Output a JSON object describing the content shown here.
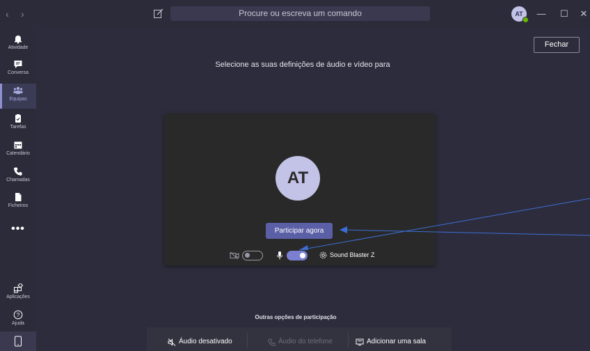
{
  "titlebar": {
    "back": "‹",
    "forward": "›",
    "search_placeholder": "Procure ou escreva um comando",
    "avatar_initials": "AT",
    "minimize": "—",
    "maximize": "☐",
    "close": "✕"
  },
  "rail": {
    "items": [
      {
        "label": "Atividade",
        "icon": "bell-icon"
      },
      {
        "label": "Conversa",
        "icon": "chat-icon"
      },
      {
        "label": "Equipas",
        "icon": "teams-icon"
      },
      {
        "label": "Tarefas",
        "icon": "tasks-icon"
      },
      {
        "label": "Calendário",
        "icon": "calendar-icon"
      },
      {
        "label": "Chamadas",
        "icon": "phone-icon"
      },
      {
        "label": "Ficheiros",
        "icon": "file-icon"
      }
    ],
    "more": "•••",
    "apps_label": "Aplicações",
    "help_label": "Ajuda"
  },
  "main": {
    "close_label": "Fechar",
    "heading": "Selecione as suas definições de áudio e vídeo para",
    "preview": {
      "avatar_initials": "AT",
      "join_label": "Participar agora",
      "camera_on": false,
      "mic_on": true,
      "device_label": "Sound Blaster Z"
    },
    "other_options": {
      "title": "Outras opções de participação",
      "audio_off": "Áudio desativado",
      "phone_audio": "Áudio do telefone",
      "add_room": "Adicionar uma sala"
    }
  },
  "colors": {
    "accent": "#5b5fa6",
    "toggle_on": "#7b7fd1",
    "annotation": "#3b6fd6"
  }
}
